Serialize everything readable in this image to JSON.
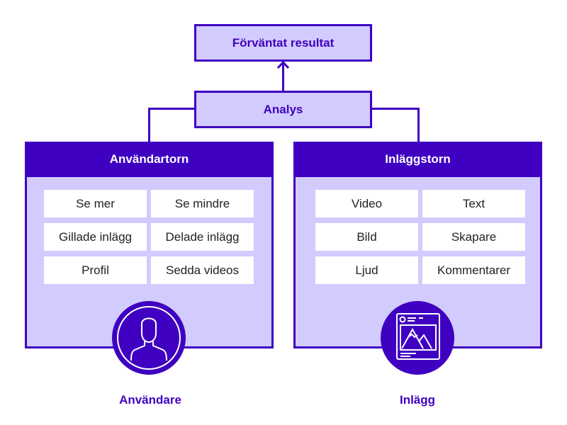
{
  "top": {
    "expected_result": "Förväntat resultat",
    "analysis": "Analys"
  },
  "user_tower": {
    "title": "Användartorn",
    "features": [
      "Se mer",
      "Se mindre",
      "Gillade inlägg",
      "Delade inlägg",
      "Profil",
      "Sedda videos"
    ],
    "icon": "user-avatar-icon",
    "caption": "Användare"
  },
  "post_tower": {
    "title": "Inläggstorn",
    "features": [
      "Video",
      "Text",
      "Bild",
      "Skapare",
      "Ljud",
      "Kommentarer"
    ],
    "icon": "post-image-icon",
    "caption": "Inlägg"
  },
  "colors": {
    "primary": "#3f00c1",
    "fill": "#d2cbfd",
    "cell": "#ffffff"
  }
}
